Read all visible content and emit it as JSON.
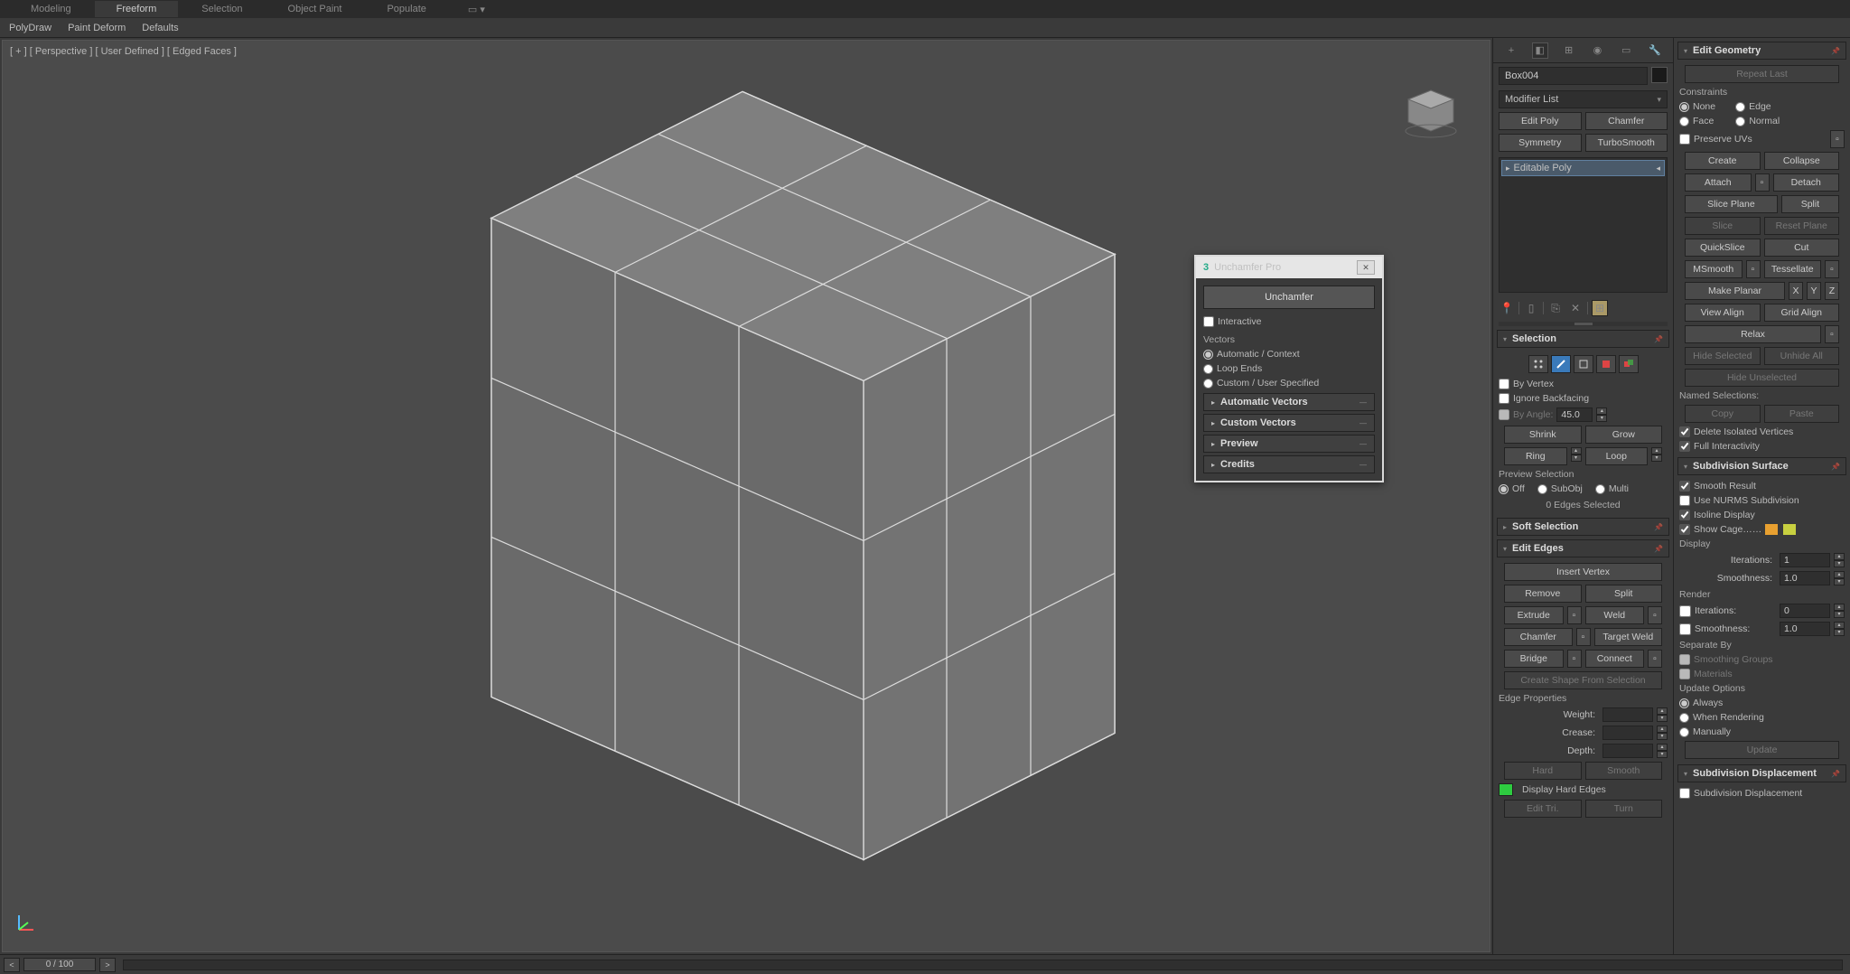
{
  "ribbon": {
    "tabs": [
      "Modeling",
      "Freeform",
      "Selection",
      "Object Paint",
      "Populate"
    ],
    "active": 1,
    "subtabs": [
      "PolyDraw",
      "Paint Deform",
      "Defaults"
    ]
  },
  "viewport": {
    "label": "[ + ] [ Perspective ] [ User Defined ] [ Edged Faces ]"
  },
  "commandPanel": {
    "objectName": "Box004",
    "modifierList": "Modifier List",
    "quickBtns": [
      [
        "Edit Poly",
        "Chamfer"
      ],
      [
        "Symmetry",
        "TurboSmooth"
      ]
    ],
    "stackItem": "Editable Poly"
  },
  "selection": {
    "title": "Selection",
    "byVertex": "By Vertex",
    "ignoreBackfacing": "Ignore Backfacing",
    "byAngle": "By Angle:",
    "byAngleVal": "45.0",
    "shrink": "Shrink",
    "grow": "Grow",
    "ring": "Ring",
    "loop": "Loop",
    "previewSel": "Preview Selection",
    "off": "Off",
    "subobj": "SubObj",
    "multi": "Multi",
    "status": "0 Edges Selected"
  },
  "softSelection": {
    "title": "Soft Selection"
  },
  "editEdges": {
    "title": "Edit Edges",
    "insertVertex": "Insert Vertex",
    "remove": "Remove",
    "split": "Split",
    "extrude": "Extrude",
    "weld": "Weld",
    "chamfer": "Chamfer",
    "targetWeld": "Target Weld",
    "bridge": "Bridge",
    "connect": "Connect",
    "createShape": "Create Shape From Selection",
    "edgeProps": "Edge Properties",
    "weight": "Weight:",
    "crease": "Crease:",
    "depth": "Depth:",
    "hard": "Hard",
    "smooth": "Smooth",
    "displayHard": "Display Hard Edges",
    "editTri": "Edit Tri.",
    "turn": "Turn"
  },
  "editGeometry": {
    "title": "Edit Geometry",
    "repeatLast": "Repeat Last",
    "constraints": "Constraints",
    "none": "None",
    "edge": "Edge",
    "face": "Face",
    "normal": "Normal",
    "preserveUVs": "Preserve UVs",
    "create": "Create",
    "collapse": "Collapse",
    "attach": "Attach",
    "detach": "Detach",
    "slicePlane": "Slice Plane",
    "splitBtn": "Split",
    "slice": "Slice",
    "resetPlane": "Reset Plane",
    "quickSlice": "QuickSlice",
    "cut": "Cut",
    "mSmooth": "MSmooth",
    "tessellate": "Tessellate",
    "makePlanar": "Make Planar",
    "x": "X",
    "y": "Y",
    "z": "Z",
    "viewAlign": "View Align",
    "gridAlign": "Grid Align",
    "relax": "Relax",
    "hideSel": "Hide Selected",
    "unhideAll": "Unhide All",
    "hideUnsel": "Hide Unselected",
    "namedSel": "Named Selections:",
    "copy": "Copy",
    "paste": "Paste",
    "deleteIso": "Delete Isolated Vertices",
    "fullInteract": "Full Interactivity"
  },
  "subdivSurface": {
    "title": "Subdivision Surface",
    "smoothResult": "Smooth Result",
    "useNURMS": "Use NURMS Subdivision",
    "isoline": "Isoline Display",
    "showCage": "Show Cage……",
    "display": "Display",
    "iterations": "Iterations:",
    "iterVal": "1",
    "smoothness": "Smoothness:",
    "smoothVal": "1.0",
    "render": "Render",
    "rIterVal": "0",
    "rSmoothVal": "1.0",
    "separateBy": "Separate By",
    "smoothingGroups": "Smoothing Groups",
    "materials": "Materials",
    "updateOpts": "Update Options",
    "always": "Always",
    "whenRendering": "When Rendering",
    "manually": "Manually",
    "update": "Update"
  },
  "subdivDisplace": {
    "title": "Subdivision Displacement",
    "check": "Subdivision Displacement"
  },
  "dialog": {
    "title": "Unchamfer Pro",
    "mainBtn": "Unchamfer",
    "interactive": "Interactive",
    "vectors": "Vectors",
    "auto": "Automatic / Context",
    "loopEnds": "Loop Ends",
    "custom": "Custom / User Specified",
    "rolls": [
      "Automatic Vectors",
      "Custom Vectors",
      "Preview",
      "Credits"
    ]
  },
  "timeline": {
    "frame": "0 / 100"
  }
}
